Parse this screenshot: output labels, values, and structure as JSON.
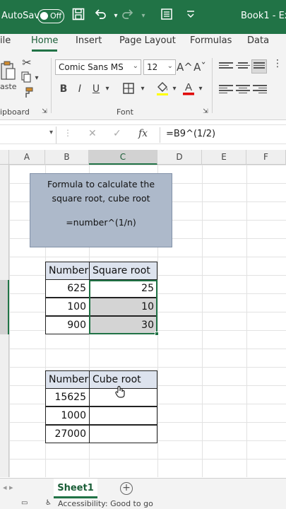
{
  "titlebar": {
    "autosave_label": "AutoSave",
    "autosave_state": "Off",
    "doc_title": "Book1 - Ex"
  },
  "ribbon_tabs": [
    "ile",
    "Home",
    "Insert",
    "Page Layout",
    "Formulas",
    "Data"
  ],
  "active_tab": "Home",
  "ribbon": {
    "clipboard_paste": "aste",
    "clipboard_group": "ipboard",
    "font_name": "Comic Sans MS",
    "font_size": "12",
    "font_group": "Font",
    "grow_font": "A^",
    "shrink_font": "Aˇ",
    "bold": "B",
    "italic": "I",
    "underline": "U"
  },
  "formula_bar": {
    "fx": "fx",
    "formula": "=B9^(1/2)"
  },
  "columns": [
    "A",
    "B",
    "C",
    "D",
    "E",
    "F"
  ],
  "selected_column": "C",
  "note": {
    "line1": "Formula to calculate  the",
    "line2": "square root, cube root",
    "line3": "=number^(1/n)"
  },
  "square_table": {
    "headers": [
      "Number",
      "Square root"
    ],
    "rows": [
      [
        "625",
        "25"
      ],
      [
        "100",
        "10"
      ],
      [
        "900",
        "30"
      ]
    ]
  },
  "cube_table": {
    "headers": [
      "Number",
      "Cube root"
    ],
    "rows": [
      [
        "15625",
        ""
      ],
      [
        "1000",
        ""
      ],
      [
        "27000",
        ""
      ]
    ]
  },
  "sheets": [
    "Sheet1"
  ],
  "status": {
    "accessibility": "Accessibility: Good to go"
  },
  "colors": {
    "excel_green": "#217346",
    "note_fill": "#adb9ca",
    "header_fill": "#dde3ee"
  }
}
